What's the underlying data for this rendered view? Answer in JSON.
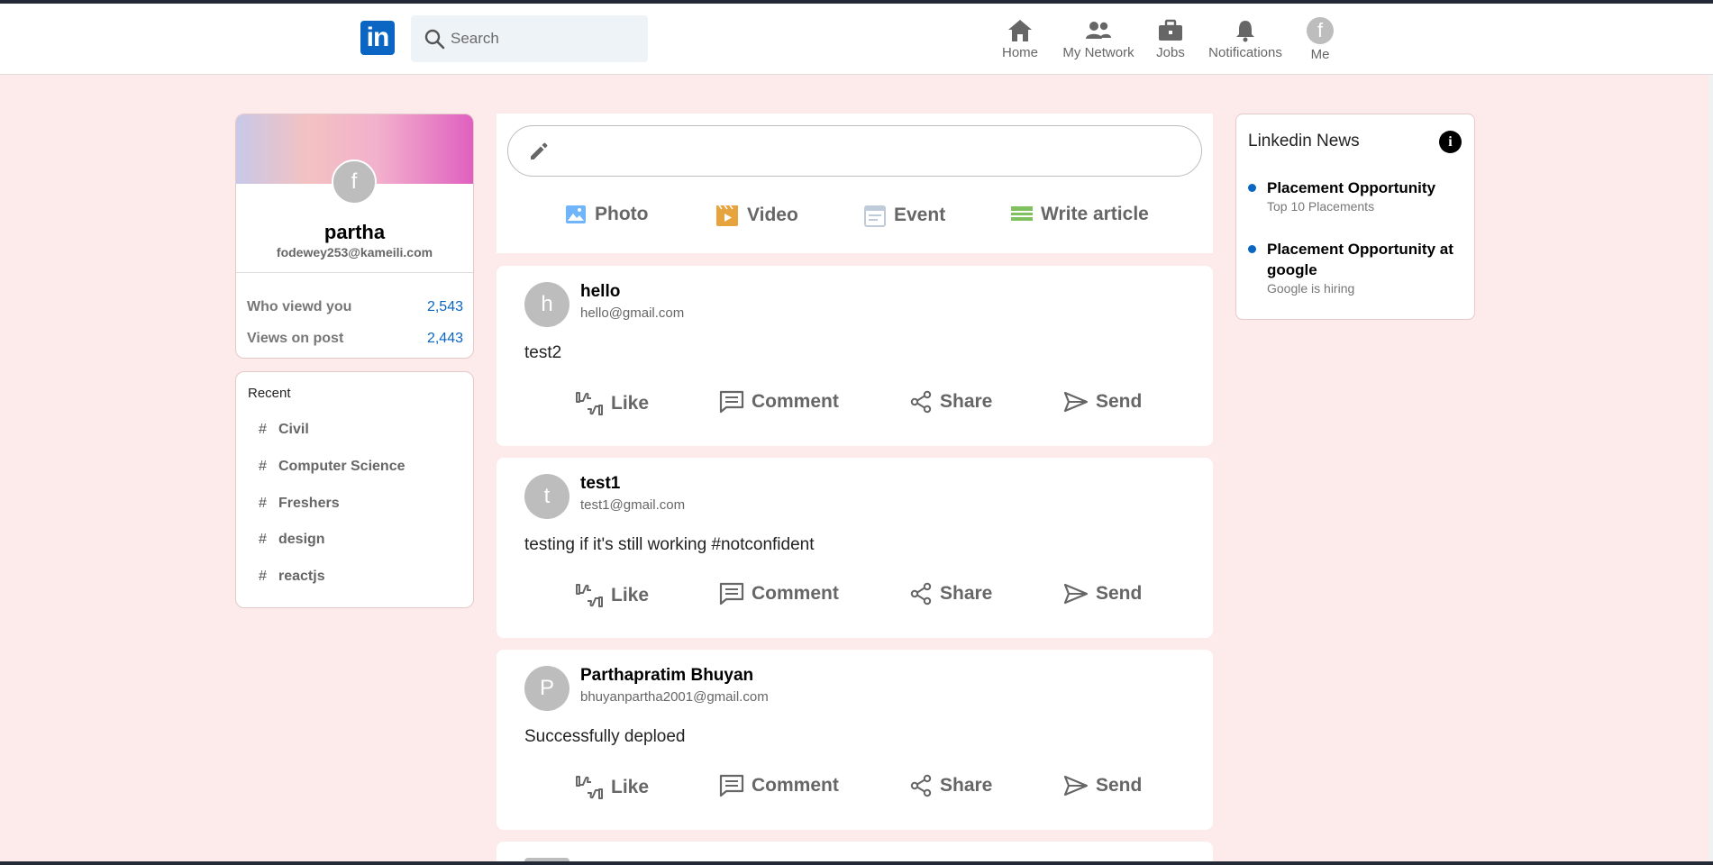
{
  "header": {
    "logo_text": "in",
    "search_placeholder": "Search",
    "nav": [
      {
        "label": "Home",
        "icon": "home-icon"
      },
      {
        "label": "My Network",
        "icon": "people-icon"
      },
      {
        "label": "Jobs",
        "icon": "briefcase-icon"
      },
      {
        "label": "Notifications",
        "icon": "bell-icon"
      },
      {
        "label": "Me",
        "icon": "avatar",
        "avatar_letter": "f"
      }
    ]
  },
  "profile": {
    "avatar_letter": "f",
    "name": "partha",
    "email": "fodewey253@kameili.com",
    "stats": [
      {
        "label": "Who viewd you",
        "value": "2,543"
      },
      {
        "label": "Views on post",
        "value": "2,443"
      }
    ]
  },
  "recent": {
    "title": "Recent",
    "hash": "#",
    "items": [
      "Civil",
      "Computer Science",
      "Freshers",
      "design",
      "reactjs"
    ]
  },
  "composer": {
    "actions": [
      {
        "label": "Photo",
        "icon": "photo-icon",
        "color": "#70b5f9"
      },
      {
        "label": "Video",
        "icon": "video-icon",
        "color": "#e7a33e"
      },
      {
        "label": "Event",
        "icon": "event-icon",
        "color": "#c0cbd9"
      },
      {
        "label": "Write article",
        "icon": "article-icon",
        "color": "#7fc15e"
      }
    ]
  },
  "posts": [
    {
      "avatar_letter": "h",
      "name": "hello",
      "email": "hello@gmail.com",
      "text": "test2"
    },
    {
      "avatar_letter": "t",
      "name": "test1",
      "email": "test1@gmail.com",
      "text": "testing if it's still working #notconfident"
    },
    {
      "avatar_letter": "P",
      "name": "Parthapratim Bhuyan",
      "email": "bhuyanpartha2001@gmail.com",
      "text": "Successfully deploed"
    }
  ],
  "post_actions": [
    "Like",
    "Comment",
    "Share",
    "Send"
  ],
  "news": {
    "title": "Linkedin News",
    "info_glyph": "i",
    "items": [
      {
        "headline": "Placement Opportunity",
        "sub": "Top 10 Placements"
      },
      {
        "headline": "Placement Opportunity at google",
        "sub": "Google is hiring"
      }
    ]
  },
  "colors": {
    "background": "#fdeaea",
    "accent": "#0a66c2",
    "text_muted": "#666666"
  }
}
